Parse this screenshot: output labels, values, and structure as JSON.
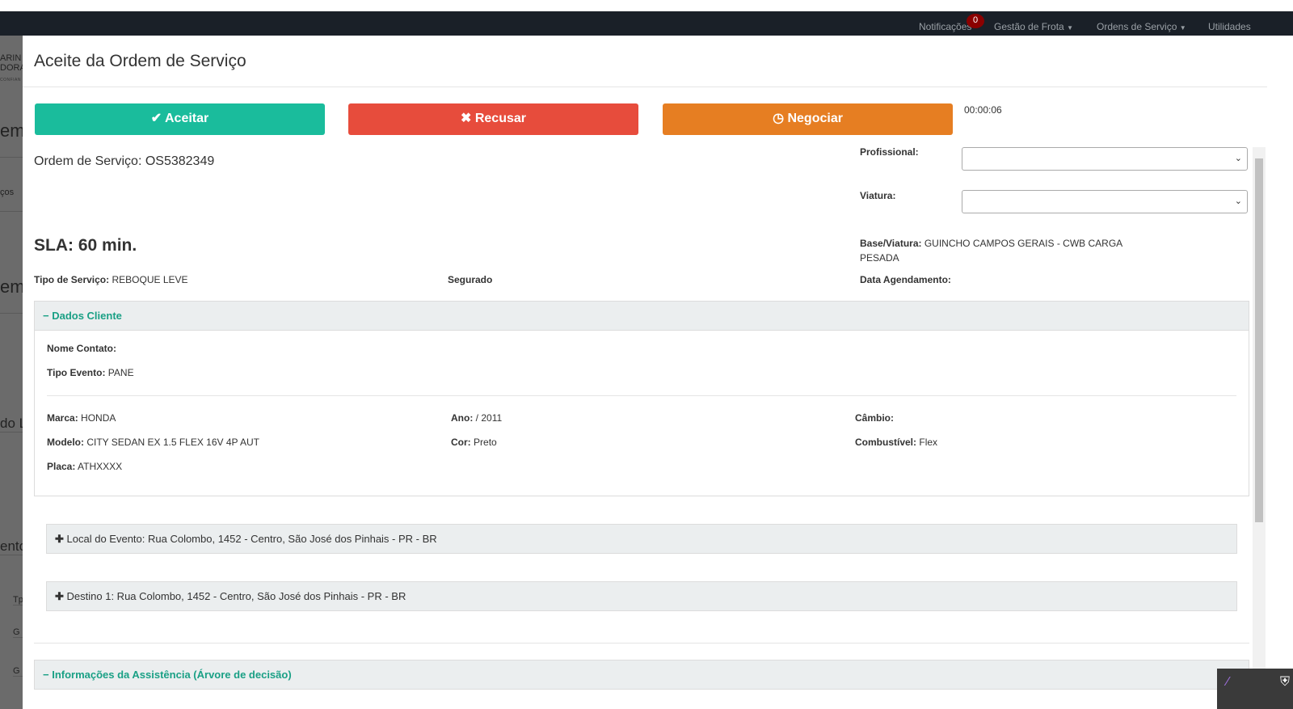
{
  "navbar": {
    "notifications": "Notificações",
    "notif_count": "0",
    "fleet": "Gestão de Frota",
    "orders": "Ordens de Serviço",
    "utilities": "Utilidades"
  },
  "background": {
    "logo1": "ARIN",
    "logo2": "DORA",
    "logo3": "CONFIAN",
    "t1": "em",
    "t2": "ços",
    "t3": "em",
    "t4": "do L",
    "t5": "ento",
    "t6": "Tp",
    "t7": "G",
    "t8": "G"
  },
  "modal": {
    "title": "Aceite da Ordem de Serviço",
    "accept": "✔ Aceitar",
    "refuse": "✖ Recusar",
    "negotiate": "◷ Negociar",
    "timer": "00:00:06",
    "order_label": "Ordem de Serviço: OS5382349",
    "professional_label": "Profissional:",
    "vehicle_label": "Viatura:",
    "professional_value": "",
    "vehicle_value": "",
    "sla": "SLA: 60 min.",
    "base_label": "Base/Viatura:",
    "base_value": "GUINCHO CAMPOS GERAIS - CWB CARGA PESADA",
    "service_type_label": "Tipo de Serviço:",
    "service_type_value": "REBOQUE LEVE",
    "insured_label": "Segurado",
    "schedule_label": "Data Agendamento:",
    "client": {
      "header": "− Dados Cliente",
      "contact_label": "Nome Contato:",
      "contact_value": "",
      "event_label": "Tipo Evento:",
      "event_value": "PANE",
      "brand_label": "Marca:",
      "brand_value": "HONDA",
      "year_label": "Ano:",
      "year_value": "/ 2011",
      "gear_label": "Câmbio:",
      "gear_value": "",
      "model_label": "Modelo:",
      "model_value": "CITY SEDAN EX 1.5 FLEX 16V 4P AUT",
      "color_label": "Cor:",
      "color_value": "Preto",
      "fuel_label": "Combustível:",
      "fuel_value": "Flex",
      "plate_label": "Placa:",
      "plate_value": "ATHXXXX"
    },
    "event_location": "Local do Evento: Rua Colombo, 1452 - Centro, São José dos Pinhais - PR - BR",
    "destination": "Destino 1: Rua Colombo, 1452 - Centro, São José dos Pinhais - PR - BR",
    "assistance_header": "− Informações da Assistência (Árvore de decisão)"
  }
}
